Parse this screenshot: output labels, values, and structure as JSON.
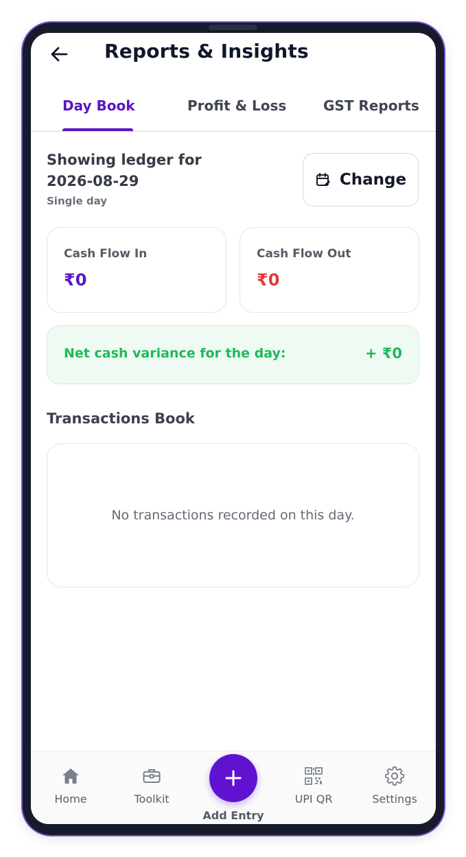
{
  "app": {
    "title": "Reports & Insights"
  },
  "tabs": [
    {
      "label": "Day Book",
      "active": true
    },
    {
      "label": "Profit & Loss",
      "active": false
    },
    {
      "label": "GST Reports",
      "active": false
    }
  ],
  "ledger": {
    "title": "Showing ledger for 2026-08-29",
    "subtitle": "Single day",
    "change_label": "Change"
  },
  "cards": {
    "cash_in": {
      "label": "Cash Flow In",
      "value": "₹0",
      "color": "#5a15c4"
    },
    "cash_out": {
      "label": "Cash Flow Out",
      "value": "₹0",
      "color": "#e03a3a"
    }
  },
  "variance": {
    "label": "Net cash variance for the day:",
    "value": "+ ₹0",
    "color": "#1fb959"
  },
  "transactions": {
    "title": "Transactions Book",
    "empty_message": "No transactions recorded on this day."
  },
  "bottom_nav": {
    "items": [
      {
        "label": "Home",
        "icon": "home-icon"
      },
      {
        "label": "Toolkit",
        "icon": "briefcase-icon"
      },
      {
        "label": "Add Entry",
        "icon": "plus-icon"
      },
      {
        "label": "UPI QR",
        "icon": "qr-code-icon"
      },
      {
        "label": "Settings",
        "icon": "gear-icon"
      }
    ]
  },
  "colors": {
    "accent": "#5a15c4",
    "danger": "#e03a3a",
    "success": "#1fb959"
  }
}
